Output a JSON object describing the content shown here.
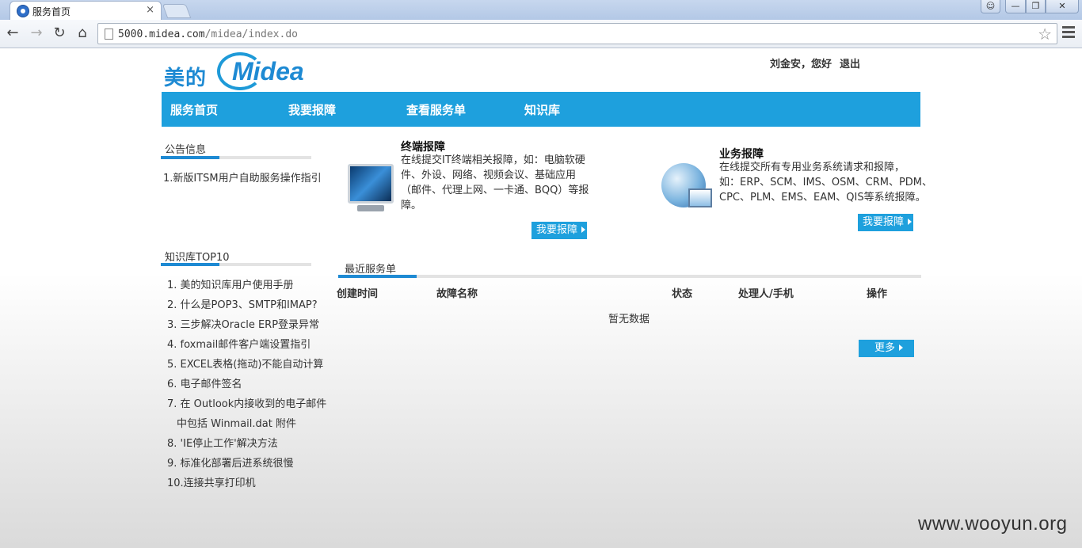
{
  "browser": {
    "tab_title": "服务首页",
    "tab_close": "×",
    "url_host": "5000.midea.com",
    "url_path": "/midea/index.do"
  },
  "header": {
    "logo_cn": "美的",
    "logo_en": "Midea",
    "user_greeting": "刘金安，您好",
    "logout_label": "退出"
  },
  "nav": {
    "items": [
      {
        "label": "服务首页"
      },
      {
        "label": "我要报障"
      },
      {
        "label": "查看服务单"
      },
      {
        "label": "知识库"
      }
    ]
  },
  "notices": {
    "title": "公告信息",
    "items": [
      "1.新版ITSM用户自助服务操作指引"
    ]
  },
  "kb": {
    "title": "知识库TOP10",
    "items": [
      "1. 美的知识库用户使用手册",
      "2. 什么是POP3、SMTP和IMAP?",
      "3. 三步解决Oracle ERP登录异常",
      "4. foxmail邮件客户端设置指引",
      "5. EXCEL表格(拖动)不能自动计算",
      "6. 电子邮件签名",
      "7. 在 Outlook内接收到的电子邮件",
      "中包括 Winmail.dat 附件",
      "8. 'IE停止工作'解决方法",
      "9. 标准化部署后进系统很慢",
      "10.连接共享打印机"
    ]
  },
  "terminal_card": {
    "title": "终端报障",
    "desc_lines": [
      "在线提交IT终端相关报障，如：电脑软硬",
      "件、外设、网络、视频会议、基础应用",
      "（邮件、代理上网、一卡通、BQQ）等报",
      "障。"
    ],
    "button": "我要报障"
  },
  "business_card": {
    "title": "业务报障",
    "desc_lines": [
      "在线提交所有专用业务系统请求和报障，",
      "如：ERP、SCM、IMS、OSM、CRM、PDM、",
      "CPC、PLM、EMS、EAM、QIS等系统报障。"
    ],
    "button": "我要报障"
  },
  "recent": {
    "title": "最近服务单",
    "columns": [
      "创建时间",
      "故障名称",
      "状态",
      "处理人/手机",
      "操作"
    ],
    "empty_text": "暂无数据",
    "more_button": "更多"
  },
  "watermark": "www.wooyun.org",
  "colors": {
    "brand_blue": "#1ea0dd",
    "logo_blue": "#1e8ad3"
  }
}
